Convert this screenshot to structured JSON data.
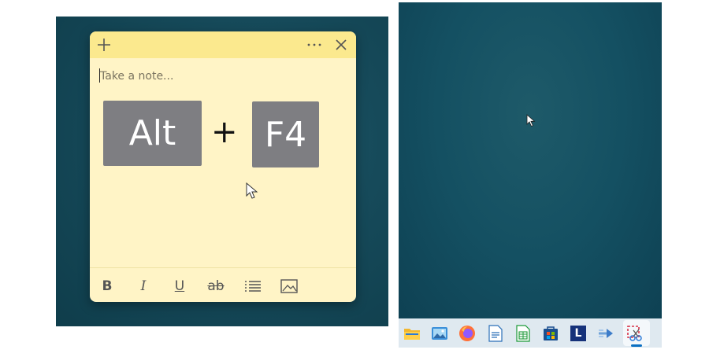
{
  "note": {
    "header_icons": [
      "plus-icon",
      "more-icon",
      "close-icon"
    ],
    "placeholder": "Take a note...",
    "keys": {
      "first": "Alt",
      "connector": "+",
      "second": "F4"
    },
    "format_toolbar": {
      "bold": "B",
      "italic": "I",
      "underline": "U",
      "strikethrough": "ab",
      "list_icon": "list-icon",
      "image_icon": "image-icon"
    }
  },
  "taskbar": {
    "icons": [
      "file-explorer-icon",
      "photos-icon",
      "firefox-icon",
      "writer-icon",
      "calc-icon",
      "store-icon",
      "l-app-icon",
      "paint-icon",
      "snipping-tool-icon"
    ],
    "l_app_letter": "L",
    "active_icon": "snipping-tool-icon"
  },
  "colors": {
    "note_body": "#fff4c6",
    "note_header": "#fbe98e",
    "key_bg": "#7e7e82",
    "desktop_teal": "#164a5a",
    "taskbar_bg": "#dfe9f0",
    "accent": "#0a6fc2"
  }
}
